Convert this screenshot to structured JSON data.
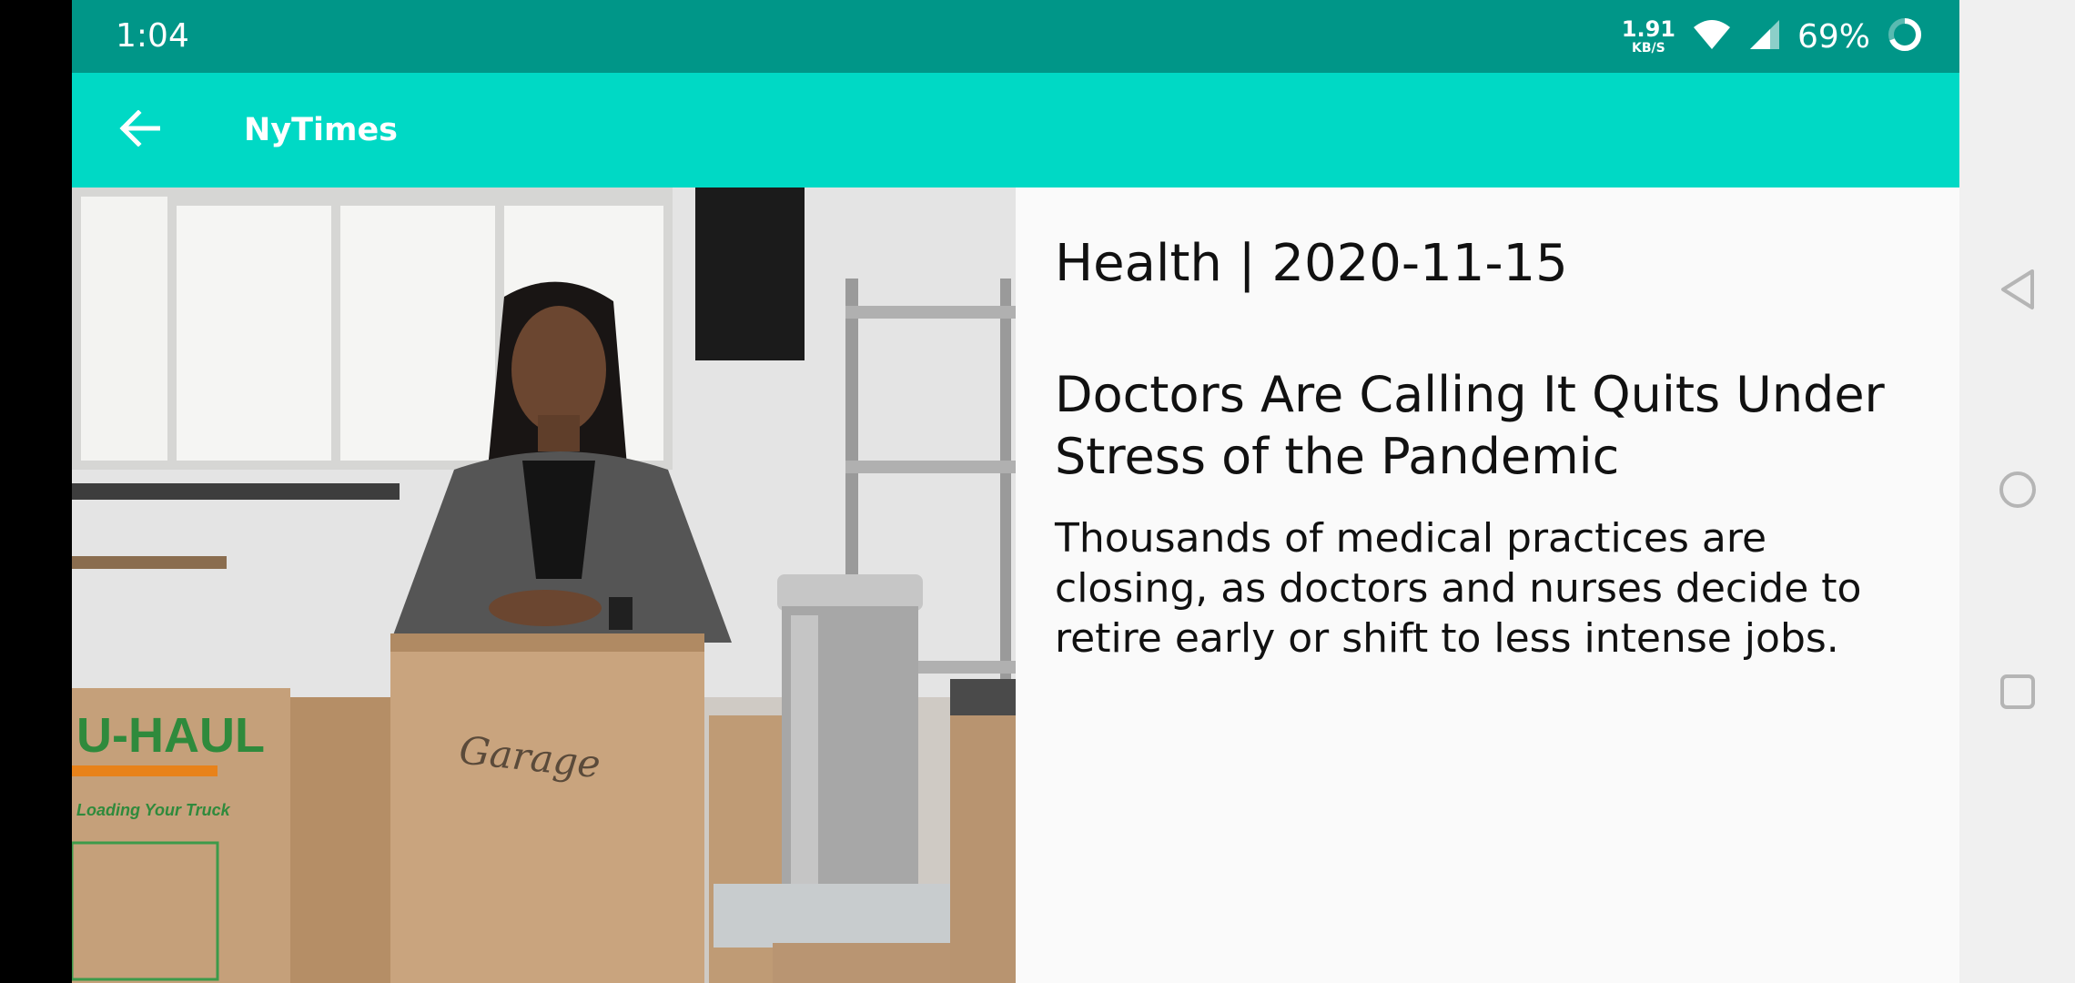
{
  "status_bar": {
    "time": "1:04",
    "net_speed_value": "1.91",
    "net_speed_unit": "KB/S",
    "battery": "69%",
    "icons": [
      "wifi-icon",
      "cell-signal-icon",
      "battery-ring-icon"
    ]
  },
  "app_bar": {
    "title": "NyTimes",
    "back_icon": "arrow-left-icon"
  },
  "article": {
    "meta": "Health | 2020-11-15",
    "headline": "Doctors Are Calling It Quits Under Stress of the Pandemic",
    "summary": "Thousands of medical practices are closing, as doctors and nurses decide to retire early or shift to less intense jobs.",
    "photo_text": {
      "box_brand": "U-HAUL",
      "box_slogan": "Loading Your Truck",
      "box_handwriting": "Garage"
    }
  },
  "nav_bar": {
    "icons": [
      "back-triangle-icon",
      "home-circle-icon",
      "recents-square-icon"
    ]
  },
  "colors": {
    "status_bar": "#009688",
    "app_bar": "#00d9c5",
    "background": "#fafafa",
    "text": "#111111"
  }
}
